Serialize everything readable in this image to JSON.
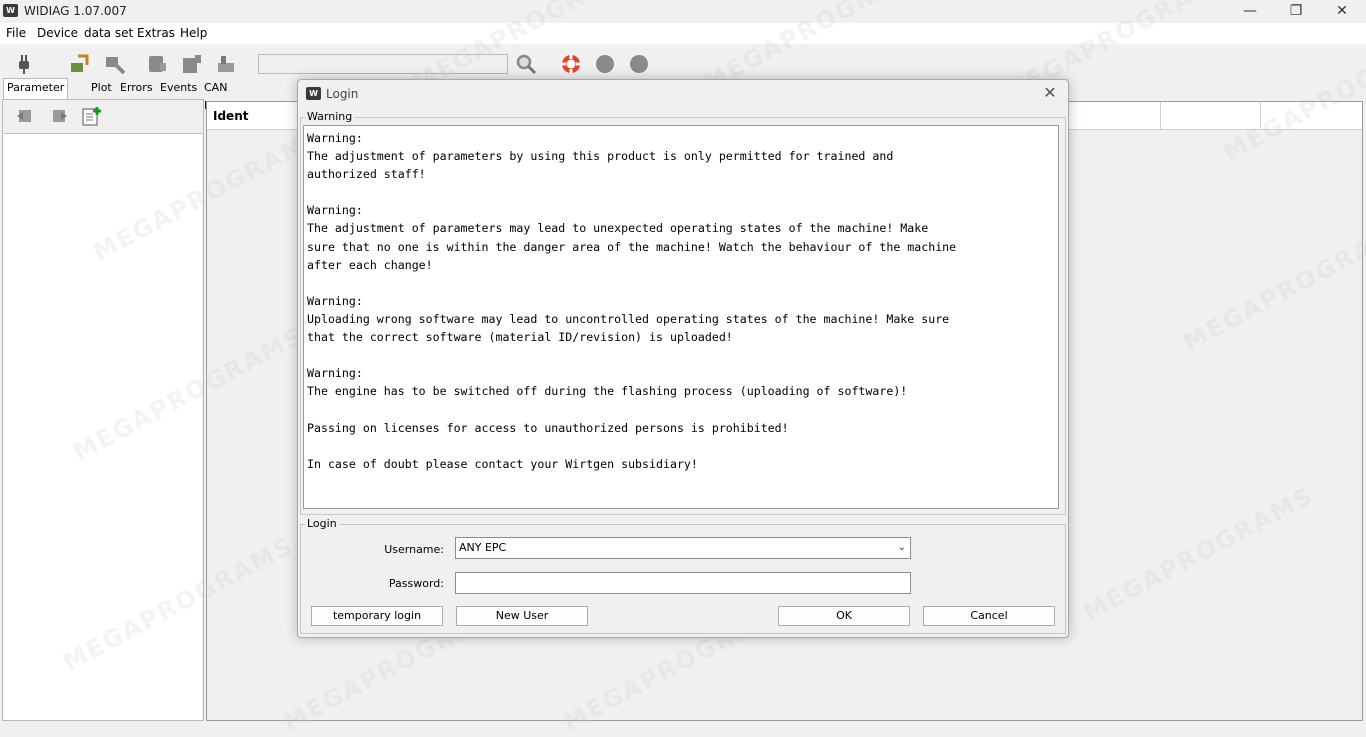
{
  "window": {
    "title": "WIDIAG 1.07.007",
    "app_icon_text": "W"
  },
  "menu": [
    "File",
    "Device",
    "data set",
    "Extras",
    "Help"
  ],
  "tabs": [
    "Parameter tree",
    "Plot",
    "Errors",
    "Events",
    "CAN Monitor"
  ],
  "main": {
    "column_header": "Ident"
  },
  "dialog": {
    "title": "Login",
    "warning_group": "Warning",
    "warning_text": "Warning:\nThe adjustment of parameters by using this product is only permitted for trained and\nauthorized staff!\n\nWarning:\nThe adjustment of parameters may lead to unexpected operating states of the machine! Make\nsure that no one is within the danger area of the machine! Watch the behaviour of the machine\nafter each change!\n\nWarning:\nUploading wrong software may lead to uncontrolled operating states of the machine! Make sure\nthat the correct software (material ID/revision) is uploaded!\n\nWarning:\nThe engine has to be switched off during the flashing process (uploading of software)!\n\nPassing on licenses for access to unauthorized persons is prohibited!\n\nIn case of doubt please contact your Wirtgen subsidiary!",
    "login_group": "Login",
    "username_label": "Username:",
    "username_value": "ANY EPC",
    "password_label": "Password:",
    "password_value": "",
    "buttons": {
      "temporary_login": "temporary login",
      "new_user": "New User",
      "ok": "OK",
      "cancel": "Cancel"
    }
  },
  "watermark_text": "MEGAPROGRAMS"
}
